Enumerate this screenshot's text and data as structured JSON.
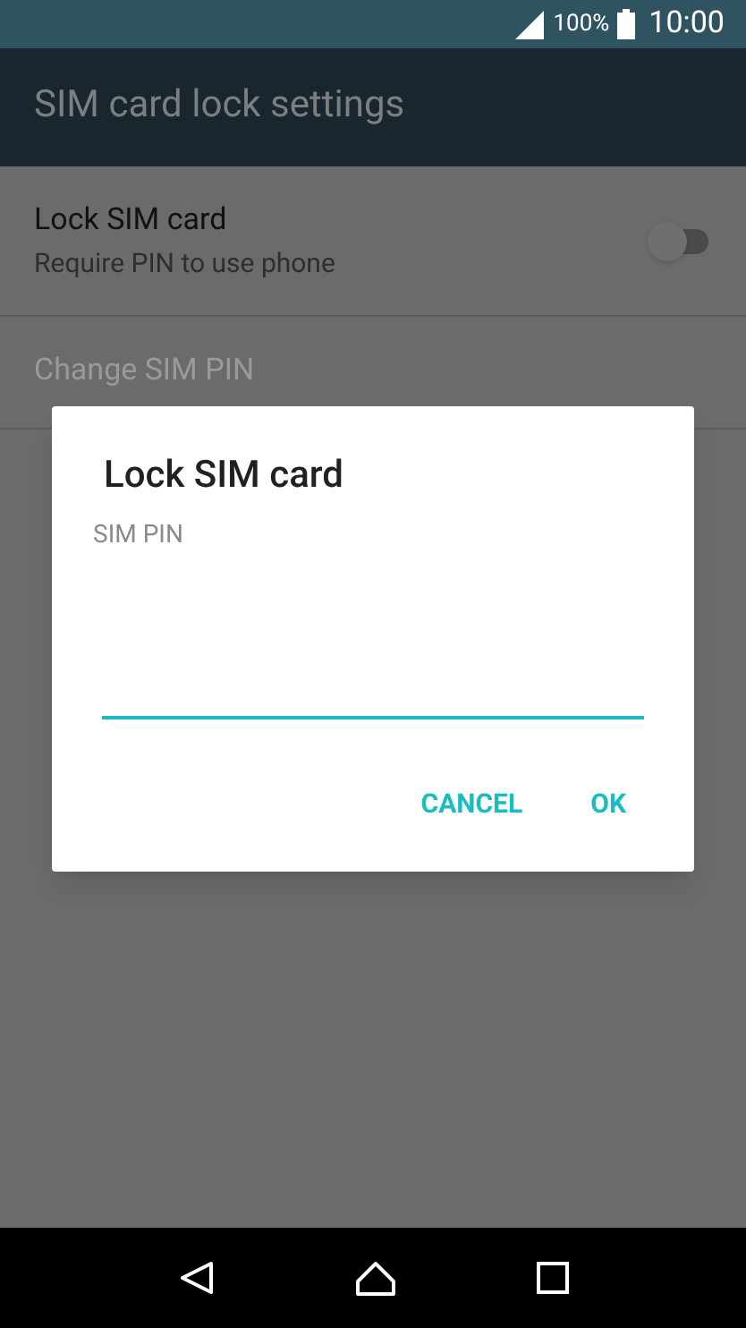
{
  "status_bar": {
    "battery": "100%",
    "time": "10:00"
  },
  "app_bar": {
    "title": "SIM card lock settings"
  },
  "settings": [
    {
      "title": "Lock SIM card",
      "summary": "Require PIN to use phone",
      "kind": "switch",
      "on": false,
      "disabled": false
    },
    {
      "title": "Change SIM PIN",
      "kind": "plain",
      "disabled": true
    }
  ],
  "dialog": {
    "title": "Lock SIM card",
    "field_label": "SIM PIN",
    "buttons": [
      "CANCEL",
      "OK"
    ]
  }
}
